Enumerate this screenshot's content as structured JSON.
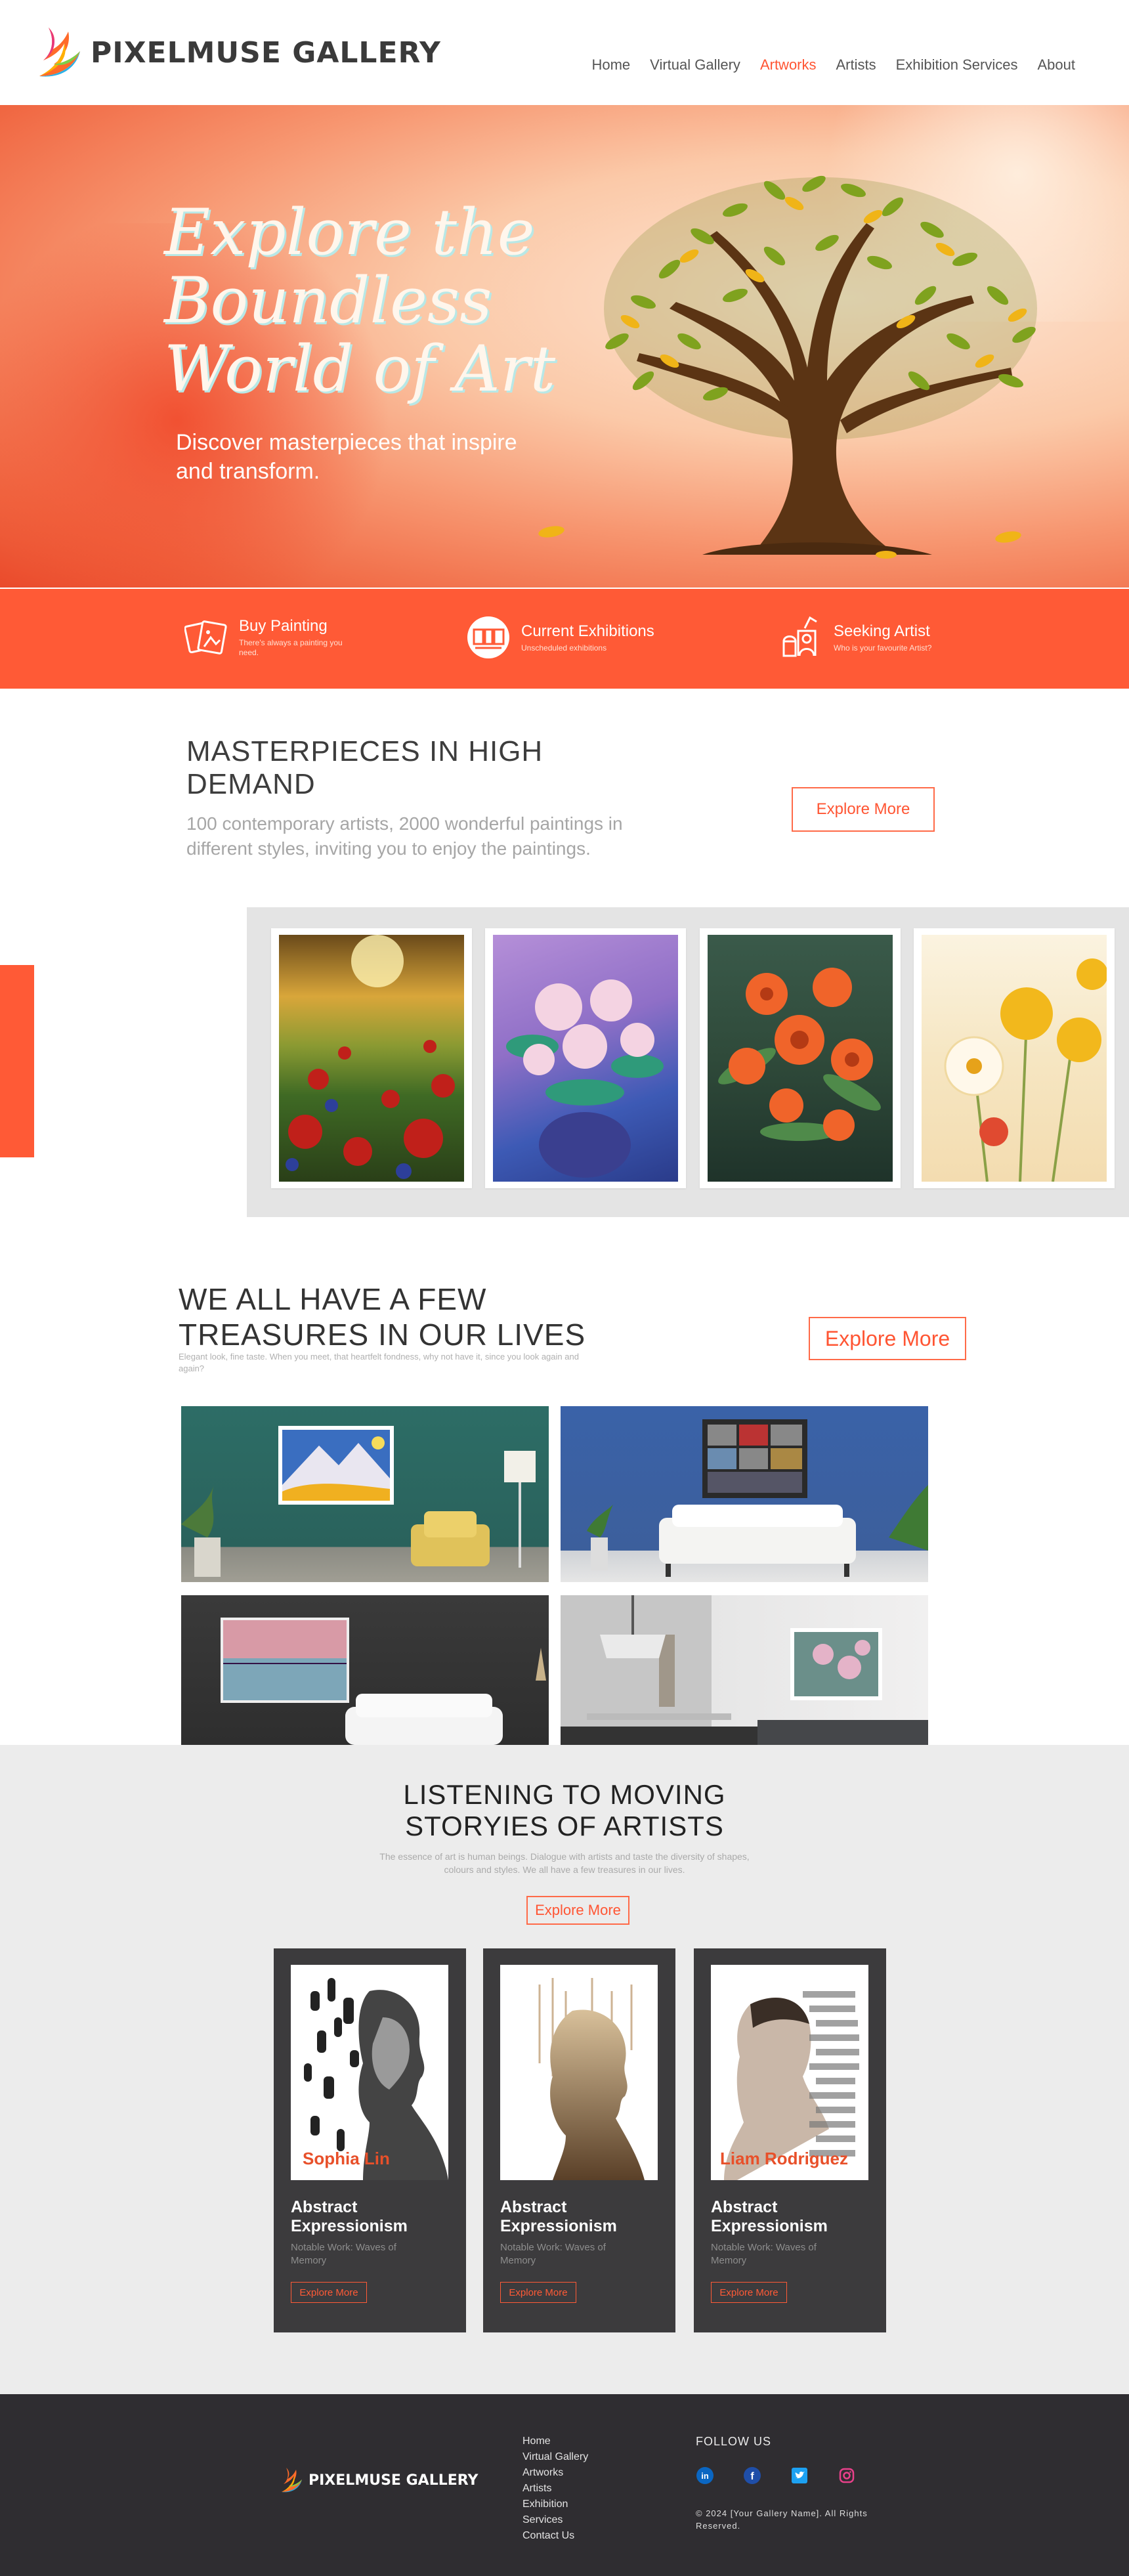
{
  "header": {
    "brand": "PIXELMUSE GALLERY",
    "nav": [
      "Home",
      "Virtual Gallery",
      "Artworks",
      "Artists",
      "Exhibition Services",
      "About"
    ],
    "active_nav": "Artworks"
  },
  "hero": {
    "title": "Explore the Boundless World of Art",
    "subtitle": "Discover masterpieces that inspire and transform."
  },
  "features": [
    {
      "title": "Buy Painting",
      "subtitle": "There's always a painting you need.",
      "icon": "paintings-icon"
    },
    {
      "title": "Current Exhibitions",
      "subtitle": "Unscheduled exhibitions",
      "icon": "exhibition-icon"
    },
    {
      "title": "Seeking Artist",
      "subtitle": "Who is your favourite Artist?",
      "icon": "artist-icon"
    }
  ],
  "masterpieces": {
    "title": "MASTERPIECES IN HIGH DEMAND",
    "description": "100 contemporary artists, 2000 wonderful paintings in different styles, inviting you to enjoy the paintings.",
    "button": "Explore More"
  },
  "treasures": {
    "title": "WE ALL HAVE A FEW TREASURES IN OUR LIVES",
    "description": "Elegant look, fine taste. When you meet, that heartfelt fondness, why not have it, since you look again and again?",
    "button": "Explore More"
  },
  "artists": {
    "title": "LISTENING TO MOVING STORYIES OF ARTISTS",
    "description": "The essence of art is human beings. Dialogue with artists and taste the diversity of shapes, colours and styles. We all have a few treasures in our lives.",
    "button": "Explore More",
    "cards": [
      {
        "style": "Abstract Expressionism",
        "work": "Notable Work: Waves of Memory",
        "button": "Explore More",
        "caption": "Sophia Lin"
      },
      {
        "style": "Abstract Expressionism",
        "work": "Notable Work: Waves of Memory",
        "button": "Explore More",
        "caption": ""
      },
      {
        "style": "Abstract Expressionism",
        "work": "Notable Work: Waves of Memory",
        "button": "Explore More",
        "caption": "Liam Rodriguez"
      }
    ]
  },
  "footer": {
    "brand": "PIXELMUSE GALLERY",
    "links": [
      "Home",
      "Virtual Gallery",
      "Artworks",
      "Artists",
      "Exhibition",
      "Services",
      "Contact Us"
    ],
    "follow": "FOLLOW US",
    "socials": [
      "linkedin-icon",
      "facebook-icon",
      "twitter-icon",
      "instagram-icon"
    ],
    "copyright": "© 2024 [Your Gallery Name]. All Rights Reserved."
  },
  "colors": {
    "accent": "#ff5a36",
    "dark": "#3c3b3d",
    "footer": "#2f2d31"
  }
}
